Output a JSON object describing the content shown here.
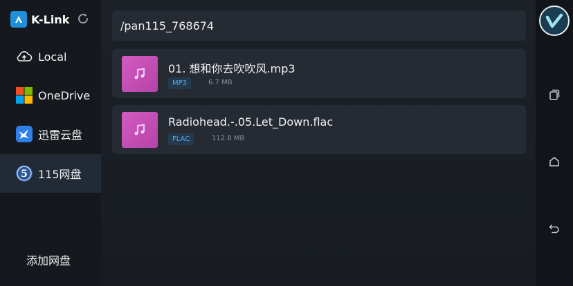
{
  "app": {
    "name": "K-Link"
  },
  "sidebar": {
    "items": [
      {
        "label": "Local",
        "icon": "cloud-upload-icon"
      },
      {
        "label": "OneDrive",
        "icon": "windows-logo-icon"
      },
      {
        "label": "迅雷云盘",
        "icon": "xunlei-bird-icon"
      },
      {
        "label": "115网盘",
        "icon": "pan115-icon",
        "active": true
      }
    ],
    "add_label": "添加网盘"
  },
  "main": {
    "path": "/pan115_768674",
    "files": [
      {
        "name": "01. 想和你去吹吹风.mp3",
        "type": "MP3",
        "size": "6.7 MB",
        "icon": "music-note-icon"
      },
      {
        "name": "Radiohead.-.05.Let_Down.flac",
        "type": "FLAC",
        "size": "112.8 MB",
        "icon": "music-note-icon"
      }
    ]
  },
  "colors": {
    "accent": "#1e8fd8",
    "thumb": "#c94fb7",
    "tag_text": "#4ea8e8",
    "active_bg": "#222a35"
  }
}
